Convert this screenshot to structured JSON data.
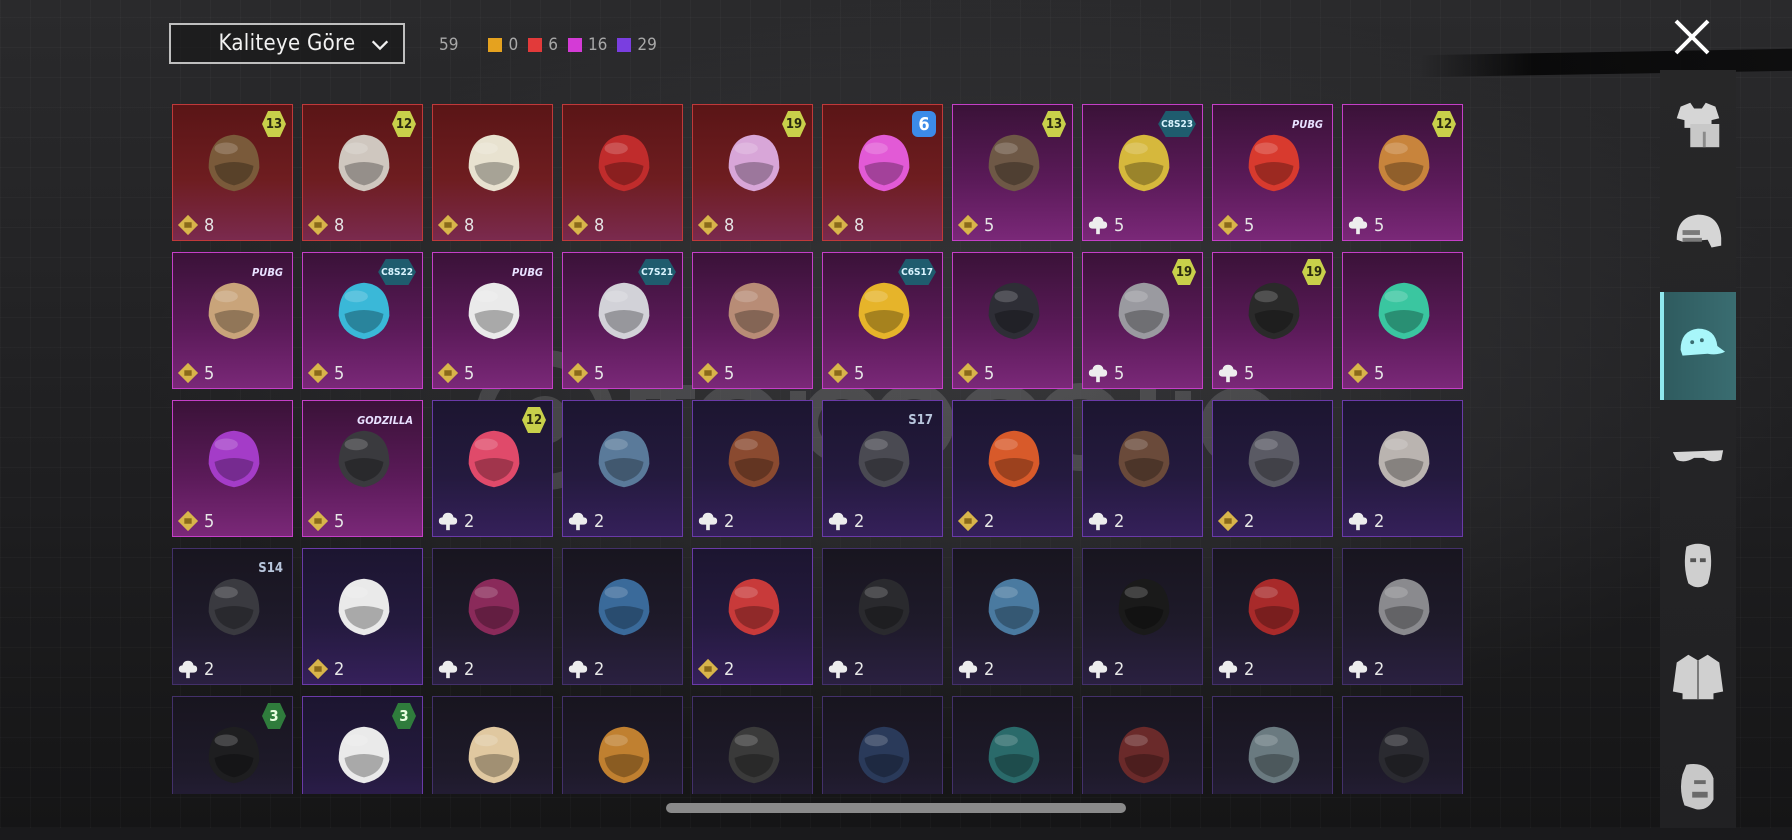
{
  "sort": {
    "label": "Kaliteye Göre"
  },
  "counts": {
    "total": "59",
    "orange": {
      "value": "0",
      "color": "#e5a21f"
    },
    "red": {
      "value": "6",
      "color": "#e23a3a"
    },
    "pink": {
      "value": "16",
      "color": "#d43bd6"
    },
    "purple": {
      "value": "29",
      "color": "#7a3ee0"
    }
  },
  "nav": [
    "outfit-icon",
    "helmet-icon",
    "hat-icon",
    "glasses-icon",
    "mask-icon",
    "jacket-icon",
    "face-icon"
  ],
  "watermark": {
    "brand": "itemsatis",
    "tagline": "OYUN / SKIN / ITEM / E-PIN",
    "domain": ".com"
  },
  "items": [
    {
      "rarity": "red",
      "badge": "13",
      "badge_type": "num",
      "currency": "gold",
      "count": "8",
      "hue": "#7a5a3a"
    },
    {
      "rarity": "red",
      "badge": "12",
      "badge_type": "num",
      "currency": "gold",
      "count": "8",
      "hue": "#cfc7bf"
    },
    {
      "rarity": "red",
      "badge": "",
      "badge_type": "",
      "currency": "gold",
      "count": "8",
      "hue": "#e8e2d0"
    },
    {
      "rarity": "red",
      "badge": "",
      "badge_type": "",
      "currency": "gold",
      "count": "8",
      "hue": "#c02c2c"
    },
    {
      "rarity": "red",
      "badge": "19",
      "badge_type": "num",
      "currency": "gold",
      "count": "8",
      "hue": "#d8a6d8"
    },
    {
      "rarity": "red",
      "badge": "6",
      "badge_type": "blue",
      "currency": "gold",
      "count": "8",
      "hue": "#e25ad6"
    },
    {
      "rarity": "pink",
      "badge": "13",
      "badge_type": "num",
      "currency": "gold",
      "count": "5",
      "hue": "#6e5846"
    },
    {
      "rarity": "pink",
      "badge": "C8S23",
      "badge_type": "season",
      "currency": "cloud",
      "count": "5",
      "hue": "#d6b83c"
    },
    {
      "rarity": "pink",
      "badge": "PUBG",
      "badge_type": "text",
      "currency": "gold",
      "count": "5",
      "hue": "#d83a2e"
    },
    {
      "rarity": "pink",
      "badge": "12",
      "badge_type": "num",
      "currency": "cloud",
      "count": "5",
      "hue": "#c8843c"
    },
    {
      "rarity": "pink",
      "badge": "PUBG",
      "badge_type": "text",
      "currency": "gold",
      "count": "5",
      "hue": "#c9a47a"
    },
    {
      "rarity": "pink",
      "badge": "C8S22",
      "badge_type": "season",
      "currency": "gold",
      "count": "5",
      "hue": "#3ab8d8"
    },
    {
      "rarity": "pink",
      "badge": "PUBG",
      "badge_type": "text",
      "currency": "gold",
      "count": "5",
      "hue": "#eaeaea"
    },
    {
      "rarity": "pink",
      "badge": "C7S21",
      "badge_type": "season",
      "currency": "gold",
      "count": "5",
      "hue": "#d2d2d8"
    },
    {
      "rarity": "pink",
      "badge": "",
      "badge_type": "",
      "currency": "gold",
      "count": "5",
      "hue": "#b88c76"
    },
    {
      "rarity": "pink",
      "badge": "C6S17",
      "badge_type": "season",
      "currency": "gold",
      "count": "5",
      "hue": "#e6b42a"
    },
    {
      "rarity": "pink",
      "badge": "",
      "badge_type": "",
      "currency": "gold",
      "count": "5",
      "hue": "#2e2e36"
    },
    {
      "rarity": "pink",
      "badge": "19",
      "badge_type": "num",
      "currency": "cloud",
      "count": "5",
      "hue": "#9a9aa0"
    },
    {
      "rarity": "pink",
      "badge": "19",
      "badge_type": "num",
      "currency": "cloud",
      "count": "5",
      "hue": "#2a2a2a"
    },
    {
      "rarity": "pink",
      "badge": "",
      "badge_type": "",
      "currency": "gold",
      "count": "5",
      "hue": "#3ac6a0"
    },
    {
      "rarity": "pink",
      "badge": "",
      "badge_type": "",
      "currency": "gold",
      "count": "5",
      "hue": "#a43cc8"
    },
    {
      "rarity": "pink",
      "badge": "GODZILLA",
      "badge_type": "text",
      "currency": "gold",
      "count": "5",
      "hue": "#3a3a3e"
    },
    {
      "rarity": "purple",
      "badge": "12",
      "badge_type": "num",
      "currency": "cloud",
      "count": "2",
      "hue": "#e04a6a"
    },
    {
      "rarity": "purple",
      "badge": "",
      "badge_type": "",
      "currency": "cloud",
      "count": "2",
      "hue": "#5a7a9a"
    },
    {
      "rarity": "purple",
      "badge": "",
      "badge_type": "",
      "currency": "cloud",
      "count": "2",
      "hue": "#8a4a30"
    },
    {
      "rarity": "purple",
      "badge": "S17",
      "badge_type": "rank",
      "currency": "cloud",
      "count": "2",
      "hue": "#4a4a52"
    },
    {
      "rarity": "purple",
      "badge": "",
      "badge_type": "",
      "currency": "gold",
      "count": "2",
      "hue": "#d85a2a"
    },
    {
      "rarity": "purple",
      "badge": "",
      "badge_type": "",
      "currency": "cloud",
      "count": "2",
      "hue": "#6a4a3a"
    },
    {
      "rarity": "purple",
      "badge": "",
      "badge_type": "",
      "currency": "gold",
      "count": "2",
      "hue": "#5a5a64"
    },
    {
      "rarity": "purple",
      "badge": "",
      "badge_type": "",
      "currency": "cloud",
      "count": "2",
      "hue": "#bab4b0"
    },
    {
      "rarity": "dark",
      "badge": "S14",
      "badge_type": "rank",
      "currency": "cloud",
      "count": "2",
      "hue": "#3a3a40"
    },
    {
      "rarity": "purple",
      "badge": "",
      "badge_type": "",
      "currency": "gold",
      "count": "2",
      "hue": "#eaeaea"
    },
    {
      "rarity": "dark",
      "badge": "",
      "badge_type": "",
      "currency": "cloud",
      "count": "2",
      "hue": "#8a2a5a"
    },
    {
      "rarity": "dark",
      "badge": "",
      "badge_type": "",
      "currency": "cloud",
      "count": "2",
      "hue": "#3a6a9a"
    },
    {
      "rarity": "purple",
      "badge": "",
      "badge_type": "",
      "currency": "gold",
      "count": "2",
      "hue": "#c83a3a"
    },
    {
      "rarity": "dark",
      "badge": "",
      "badge_type": "",
      "currency": "cloud",
      "count": "2",
      "hue": "#2a2a2e"
    },
    {
      "rarity": "dark",
      "badge": "",
      "badge_type": "",
      "currency": "cloud",
      "count": "2",
      "hue": "#4a7aa0"
    },
    {
      "rarity": "dark",
      "badge": "",
      "badge_type": "",
      "currency": "cloud",
      "count": "2",
      "hue": "#1a1a1a"
    },
    {
      "rarity": "dark",
      "badge": "",
      "badge_type": "",
      "currency": "cloud",
      "count": "2",
      "hue": "#a82a2a"
    },
    {
      "rarity": "dark",
      "badge": "",
      "badge_type": "",
      "currency": "cloud",
      "count": "2",
      "hue": "#8a8a8e"
    },
    {
      "rarity": "dark",
      "badge": "3",
      "badge_type": "green",
      "currency": "",
      "count": "",
      "hue": "#1e1e20"
    },
    {
      "rarity": "purple",
      "badge": "3",
      "badge_type": "green",
      "currency": "",
      "count": "",
      "hue": "#eaeaea"
    },
    {
      "rarity": "dark",
      "badge": "",
      "badge_type": "",
      "currency": "",
      "count": "",
      "hue": "#e0c8a0"
    },
    {
      "rarity": "dark",
      "badge": "",
      "badge_type": "",
      "currency": "",
      "count": "",
      "hue": "#c08030"
    },
    {
      "rarity": "dark",
      "badge": "",
      "badge_type": "",
      "currency": "",
      "count": "",
      "hue": "#3a3a3a"
    },
    {
      "rarity": "dark",
      "badge": "",
      "badge_type": "",
      "currency": "",
      "count": "",
      "hue": "#2a3a5a"
    },
    {
      "rarity": "dark",
      "badge": "",
      "badge_type": "",
      "currency": "",
      "count": "",
      "hue": "#2a6a6a"
    },
    {
      "rarity": "dark",
      "badge": "",
      "badge_type": "",
      "currency": "",
      "count": "",
      "hue": "#6a2a2a"
    },
    {
      "rarity": "dark",
      "badge": "",
      "badge_type": "",
      "currency": "",
      "count": "",
      "hue": "#6a7a80"
    },
    {
      "rarity": "dark",
      "badge": "",
      "badge_type": "",
      "currency": "",
      "count": "",
      "hue": "#2a2a30"
    }
  ]
}
